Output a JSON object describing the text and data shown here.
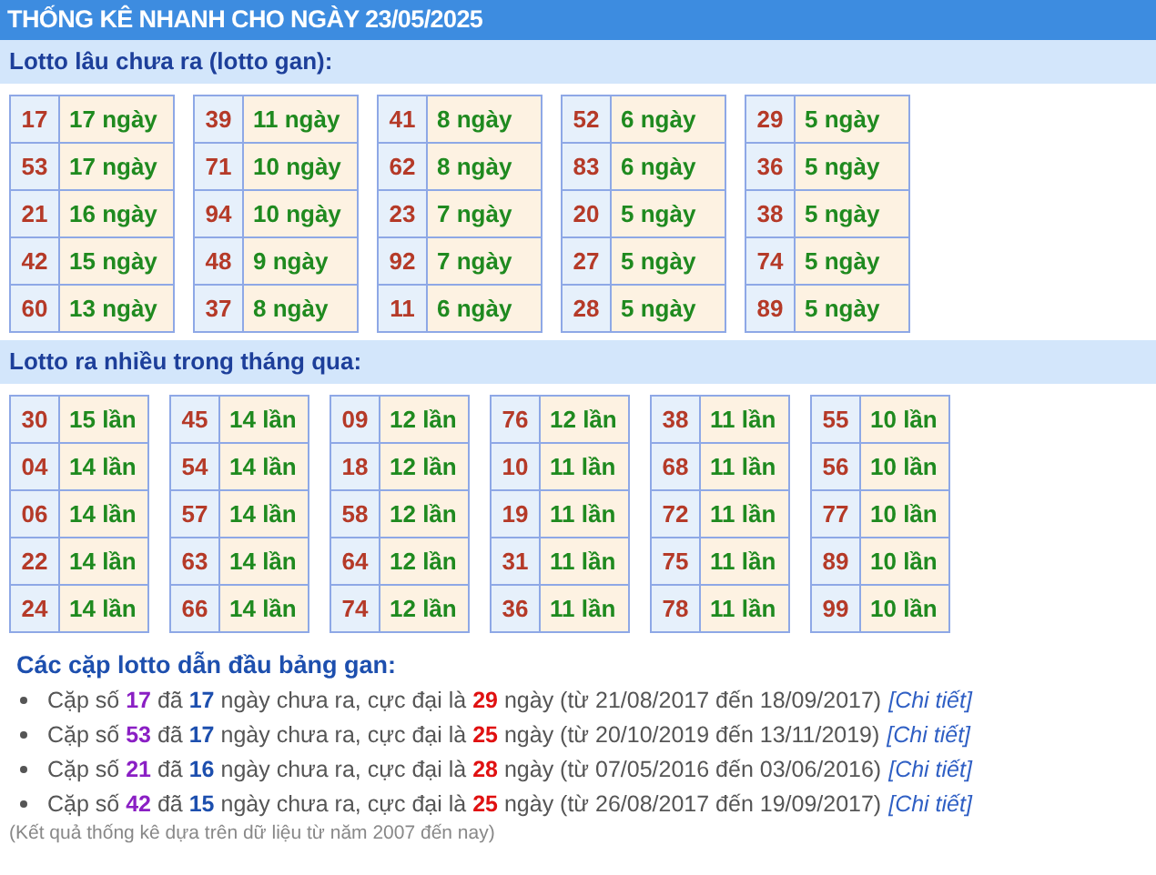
{
  "title": "THỐNG KÊ NHANH CHO NGÀY 23/05/2025",
  "gan": {
    "heading": "Lotto lâu chưa ra (lotto gan):",
    "tables": [
      [
        {
          "number": "17",
          "value": "17 ngày"
        },
        {
          "number": "53",
          "value": "17 ngày"
        },
        {
          "number": "21",
          "value": "16 ngày"
        },
        {
          "number": "42",
          "value": "15 ngày"
        },
        {
          "number": "60",
          "value": "13 ngày"
        }
      ],
      [
        {
          "number": "39",
          "value": "11 ngày"
        },
        {
          "number": "71",
          "value": "10 ngày"
        },
        {
          "number": "94",
          "value": "10 ngày"
        },
        {
          "number": "48",
          "value": "9 ngày"
        },
        {
          "number": "37",
          "value": "8 ngày"
        }
      ],
      [
        {
          "number": "41",
          "value": "8 ngày"
        },
        {
          "number": "62",
          "value": "8 ngày"
        },
        {
          "number": "23",
          "value": "7 ngày"
        },
        {
          "number": "92",
          "value": "7 ngày"
        },
        {
          "number": "11",
          "value": "6 ngày"
        }
      ],
      [
        {
          "number": "52",
          "value": "6 ngày"
        },
        {
          "number": "83",
          "value": "6 ngày"
        },
        {
          "number": "20",
          "value": "5 ngày"
        },
        {
          "number": "27",
          "value": "5 ngày"
        },
        {
          "number": "28",
          "value": "5 ngày"
        }
      ],
      [
        {
          "number": "29",
          "value": "5 ngày"
        },
        {
          "number": "36",
          "value": "5 ngày"
        },
        {
          "number": "38",
          "value": "5 ngày"
        },
        {
          "number": "74",
          "value": "5 ngày"
        },
        {
          "number": "89",
          "value": "5 ngày"
        }
      ]
    ]
  },
  "frequent": {
    "heading": "Lotto ra nhiều trong tháng qua:",
    "tables": [
      [
        {
          "number": "30",
          "value": "15 lần"
        },
        {
          "number": "04",
          "value": "14 lần"
        },
        {
          "number": "06",
          "value": "14 lần"
        },
        {
          "number": "22",
          "value": "14 lần"
        },
        {
          "number": "24",
          "value": "14 lần"
        }
      ],
      [
        {
          "number": "45",
          "value": "14 lần"
        },
        {
          "number": "54",
          "value": "14 lần"
        },
        {
          "number": "57",
          "value": "14 lần"
        },
        {
          "number": "63",
          "value": "14 lần"
        },
        {
          "number": "66",
          "value": "14 lần"
        }
      ],
      [
        {
          "number": "09",
          "value": "12 lần"
        },
        {
          "number": "18",
          "value": "12 lần"
        },
        {
          "number": "58",
          "value": "12 lần"
        },
        {
          "number": "64",
          "value": "12 lần"
        },
        {
          "number": "74",
          "value": "12 lần"
        }
      ],
      [
        {
          "number": "76",
          "value": "12 lần"
        },
        {
          "number": "10",
          "value": "11 lần"
        },
        {
          "number": "19",
          "value": "11 lần"
        },
        {
          "number": "31",
          "value": "11 lần"
        },
        {
          "number": "36",
          "value": "11 lần"
        }
      ],
      [
        {
          "number": "38",
          "value": "11 lần"
        },
        {
          "number": "68",
          "value": "11 lần"
        },
        {
          "number": "72",
          "value": "11 lần"
        },
        {
          "number": "75",
          "value": "11 lần"
        },
        {
          "number": "78",
          "value": "11 lần"
        }
      ],
      [
        {
          "number": "55",
          "value": "10 lần"
        },
        {
          "number": "56",
          "value": "10 lần"
        },
        {
          "number": "77",
          "value": "10 lần"
        },
        {
          "number": "89",
          "value": "10 lần"
        },
        {
          "number": "99",
          "value": "10 lần"
        }
      ]
    ]
  },
  "pairs": {
    "heading": "Các cặp lotto dẫn đầu bảng gan:",
    "items": [
      {
        "segments": [
          {
            "kind": "plain",
            "text": "Cặp số "
          },
          {
            "kind": "pair",
            "text": "17"
          },
          {
            "kind": "plain",
            "text": " đã "
          },
          {
            "kind": "days",
            "text": "17"
          },
          {
            "kind": "plain",
            "text": " ngày chưa ra, cực đại là "
          },
          {
            "kind": "max",
            "text": "29"
          },
          {
            "kind": "plain",
            "text": " ngày (từ 21/08/2017 đến 18/09/2017)"
          }
        ],
        "link": "[Chi tiết]"
      },
      {
        "segments": [
          {
            "kind": "plain",
            "text": "Cặp số "
          },
          {
            "kind": "pair",
            "text": "53"
          },
          {
            "kind": "plain",
            "text": " đã "
          },
          {
            "kind": "days",
            "text": "17"
          },
          {
            "kind": "plain",
            "text": " ngày chưa ra, cực đại là "
          },
          {
            "kind": "max",
            "text": "25"
          },
          {
            "kind": "plain",
            "text": " ngày (từ 20/10/2019 đến 13/11/2019)"
          }
        ],
        "link": "[Chi tiết]"
      },
      {
        "segments": [
          {
            "kind": "plain",
            "text": "Cặp số "
          },
          {
            "kind": "pair",
            "text": "21"
          },
          {
            "kind": "plain",
            "text": " đã "
          },
          {
            "kind": "days",
            "text": "16"
          },
          {
            "kind": "plain",
            "text": " ngày chưa ra, cực đại là "
          },
          {
            "kind": "max",
            "text": "28"
          },
          {
            "kind": "plain",
            "text": " ngày (từ 07/05/2016 đến 03/06/2016)"
          }
        ],
        "link": "[Chi tiết]"
      },
      {
        "segments": [
          {
            "kind": "plain",
            "text": "Cặp số "
          },
          {
            "kind": "pair",
            "text": "42"
          },
          {
            "kind": "plain",
            "text": " đã "
          },
          {
            "kind": "days",
            "text": "15"
          },
          {
            "kind": "plain",
            "text": " ngày chưa ra, cực đại là "
          },
          {
            "kind": "max",
            "text": "25"
          },
          {
            "kind": "plain",
            "text": " ngày (từ 26/08/2017 đến 19/09/2017)"
          }
        ],
        "link": "[Chi tiết]"
      }
    ],
    "note": "(Kết quả thống kê dựa trên dữ liệu từ năm 2007 đến nay)"
  }
}
